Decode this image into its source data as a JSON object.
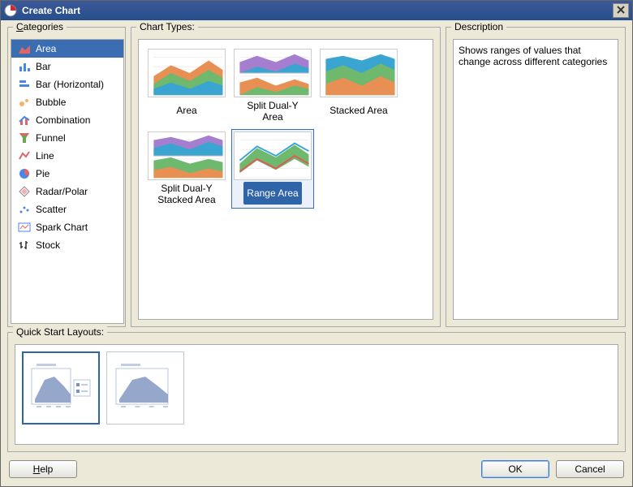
{
  "title": "Create Chart",
  "categories": {
    "legend": "Categories",
    "items": [
      {
        "label": "Area",
        "icon": "area-icon",
        "selected": true
      },
      {
        "label": "Bar",
        "icon": "bar-icon",
        "selected": false
      },
      {
        "label": "Bar (Horizontal)",
        "icon": "hbar-icon",
        "selected": false
      },
      {
        "label": "Bubble",
        "icon": "bubble-icon",
        "selected": false
      },
      {
        "label": "Combination",
        "icon": "combo-icon",
        "selected": false
      },
      {
        "label": "Funnel",
        "icon": "funnel-icon",
        "selected": false
      },
      {
        "label": "Line",
        "icon": "line-icon",
        "selected": false
      },
      {
        "label": "Pie",
        "icon": "pie-icon",
        "selected": false
      },
      {
        "label": "Radar/Polar",
        "icon": "radar-icon",
        "selected": false
      },
      {
        "label": "Scatter",
        "icon": "scatter-icon",
        "selected": false
      },
      {
        "label": "Spark Chart",
        "icon": "spark-icon",
        "selected": false
      },
      {
        "label": "Stock",
        "icon": "stock-icon",
        "selected": false
      }
    ]
  },
  "chartTypes": {
    "legend": "Chart Types:",
    "items": [
      {
        "label": "Area",
        "selected": false
      },
      {
        "label": "Split Dual-Y Area",
        "selected": false
      },
      {
        "label": "Stacked Area",
        "selected": false
      },
      {
        "label": "Split Dual-Y Stacked Area",
        "selected": false
      },
      {
        "label": "Range Area",
        "selected": true
      }
    ]
  },
  "description": {
    "legend": "Description",
    "text": "Shows ranges of values that change across different categories"
  },
  "quickStart": {
    "legend": "Quick Start Layouts:",
    "items": [
      {
        "selected": true,
        "hasLegend": true
      },
      {
        "selected": false,
        "hasLegend": false
      }
    ]
  },
  "buttons": {
    "help": "Help",
    "ok": "OK",
    "cancel": "Cancel"
  }
}
